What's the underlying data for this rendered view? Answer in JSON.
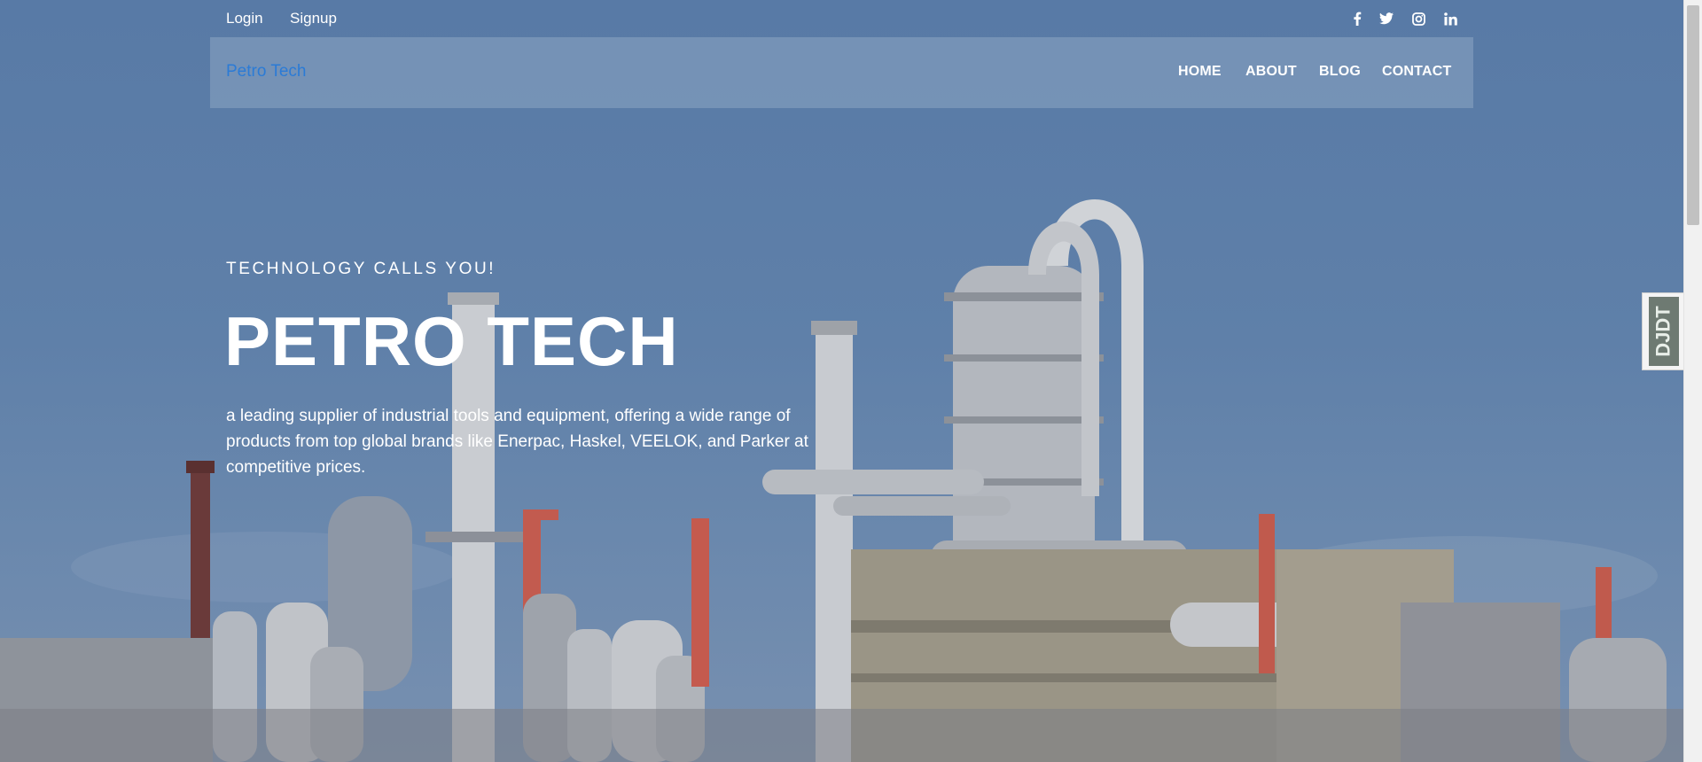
{
  "topbar": {
    "login_label": "Login",
    "signup_label": "Signup",
    "social_icons": [
      "facebook-icon",
      "twitter-icon",
      "instagram-icon",
      "linkedin-icon"
    ]
  },
  "navbar": {
    "brand": "Petro Tech",
    "items": [
      {
        "label": "HOME"
      },
      {
        "label": "ABOUT"
      },
      {
        "label": "BLOG"
      },
      {
        "label": "CONTACT"
      }
    ]
  },
  "hero": {
    "eyebrow": "TECHNOLOGY CALLS YOU!",
    "title": "PETRO TECH",
    "description": "a leading supplier of industrial tools and equipment, offering a wide range of products from top global brands like Enerpac, Haskel, VEELOK, and Parker at competitive prices."
  },
  "side_widget": {
    "label": "DJDT"
  },
  "colors": {
    "brand": "#2b7bd6",
    "text": "#ffffff",
    "overlay": "#5a7aa3"
  }
}
